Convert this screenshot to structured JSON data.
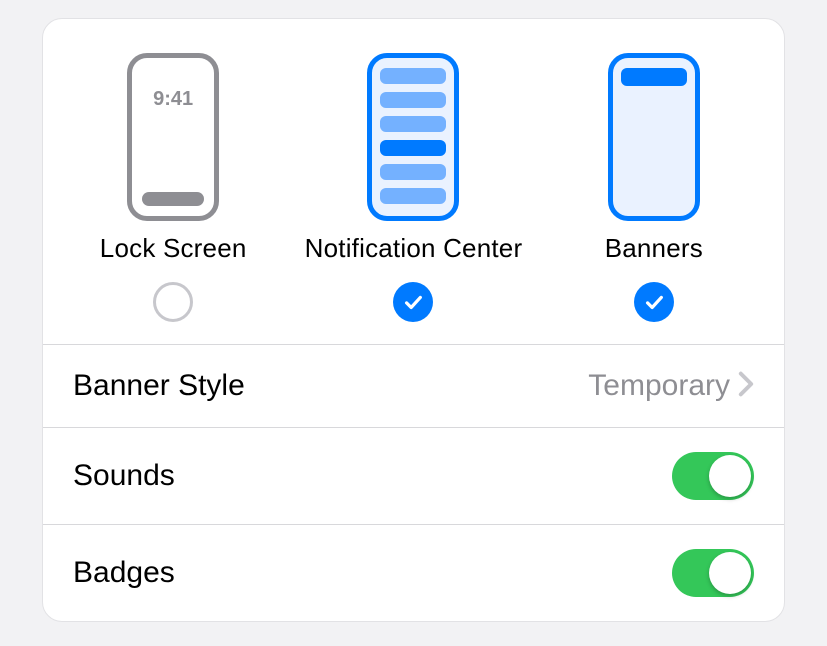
{
  "alerts": {
    "lock_screen": {
      "label": "Lock Screen",
      "time": "9:41",
      "checked": false
    },
    "notification_center": {
      "label": "Notification Center",
      "checked": true
    },
    "banners": {
      "label": "Banners",
      "checked": true
    }
  },
  "banner_style": {
    "label": "Banner Style",
    "value": "Temporary"
  },
  "sounds": {
    "label": "Sounds",
    "on": true
  },
  "badges": {
    "label": "Badges",
    "on": true
  },
  "colors": {
    "accent": "#007aff",
    "toggle_on": "#34c759",
    "secondary": "#8e8e93"
  }
}
